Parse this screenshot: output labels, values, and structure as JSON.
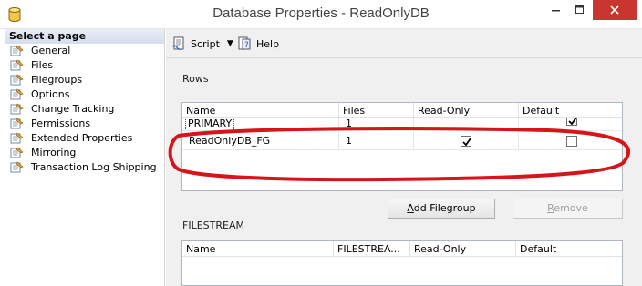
{
  "window": {
    "title": "Database Properties - ReadOnlyDB"
  },
  "sidebar": {
    "header": "Select a page",
    "items": [
      {
        "label": "General"
      },
      {
        "label": "Files"
      },
      {
        "label": "Filegroups"
      },
      {
        "label": "Options"
      },
      {
        "label": "Change Tracking"
      },
      {
        "label": "Permissions"
      },
      {
        "label": "Extended Properties"
      },
      {
        "label": "Mirroring"
      },
      {
        "label": "Transaction Log Shipping"
      }
    ]
  },
  "toolbar": {
    "script_label": "Script",
    "help_label": "Help"
  },
  "rows_section": {
    "label": "Rows",
    "columns": [
      "Name",
      "Files",
      "Read-Only",
      "Default"
    ],
    "rows": [
      {
        "name": "PRIMARY",
        "files": "1",
        "read_only": false,
        "default": true
      },
      {
        "name": "ReadOnlyDB_FG",
        "files": "1",
        "read_only": true,
        "default": false
      }
    ],
    "add_button": "Add Filegroup",
    "remove_button": "Remove"
  },
  "filestream_section": {
    "label": "FILESTREAM",
    "columns": [
      "Name",
      "FILESTREA...",
      "Read-Only",
      "Default"
    ]
  },
  "annotation": {
    "color": "#d6151b"
  }
}
